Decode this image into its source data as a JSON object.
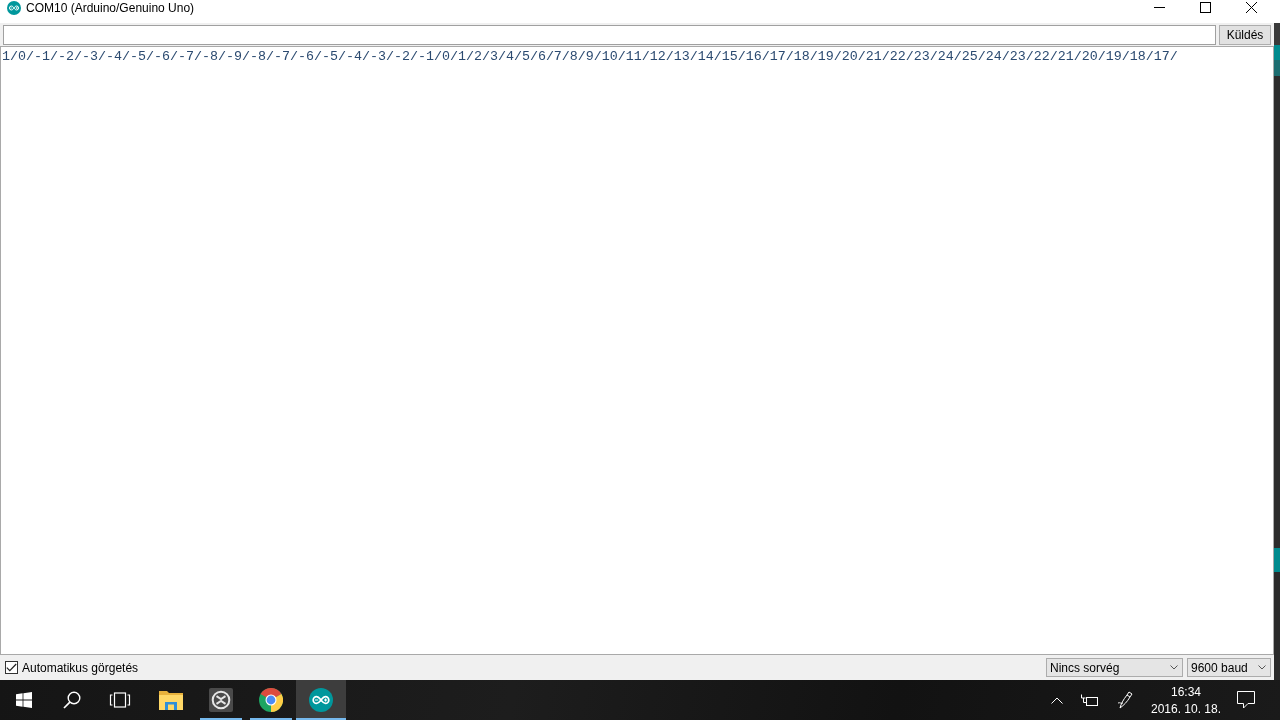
{
  "window": {
    "title": "COM10 (Arduino/Genuino Uno)"
  },
  "send_bar": {
    "send_button": "Küldés"
  },
  "serial_output": {
    "lines": [
      "1/0/-1/-2/-3/-4/-5/-6/-7/-8/-9/-8/-7/-6/-5/-4/-3/-2/-1/0/1/2/3/4/5/6/7/8/9/10/11/12/13/14/15/16/17/18/19/20/21/22/23/24/25/24/23/22/21/20/19/18/17/"
    ]
  },
  "status_bar": {
    "autoscroll": {
      "label": "Automatikus görgetés",
      "checked": true
    },
    "line_ending": "Nincs sorvég",
    "baud_rate": "9600 baud"
  },
  "taskbar": {
    "buttons": [
      {
        "kind": "start"
      },
      {
        "kind": "search"
      },
      {
        "kind": "taskview"
      }
    ],
    "apps": [
      {
        "kind": "explorer",
        "running": false,
        "selected": false
      },
      {
        "kind": "emblem",
        "running": true,
        "selected": false
      },
      {
        "kind": "browser",
        "running": true,
        "selected": false
      },
      {
        "kind": "ide",
        "running": true,
        "selected": true
      }
    ],
    "tray": {
      "icons": [
        {
          "kind": "chevron"
        },
        {
          "kind": "power"
        },
        {
          "kind": "pen"
        }
      ],
      "clock": {
        "time": "16:34",
        "date": "2016. 10. 18."
      }
    }
  }
}
